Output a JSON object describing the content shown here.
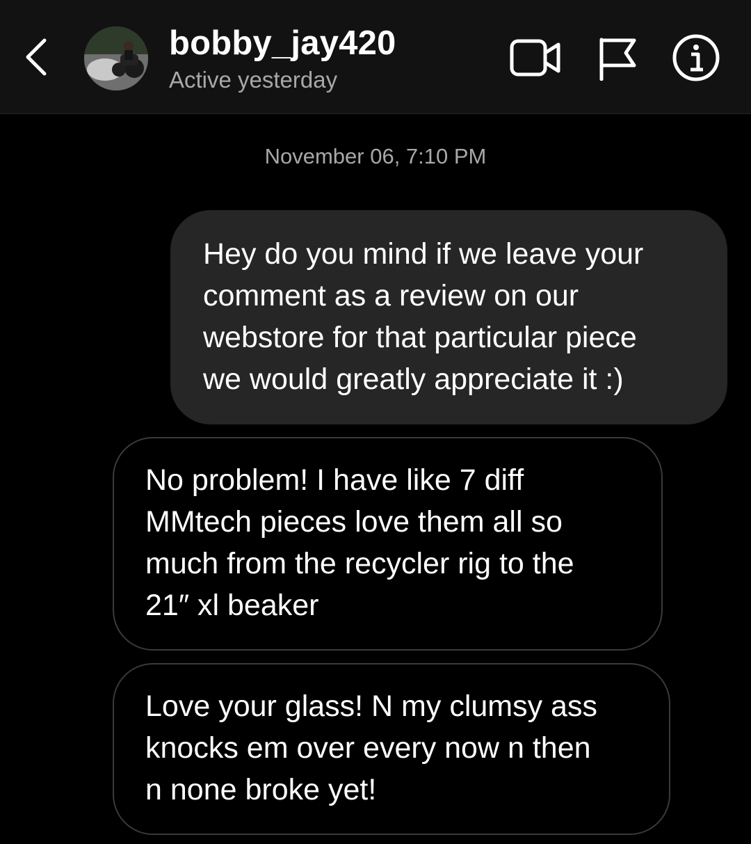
{
  "header": {
    "username": "bobby_jay420",
    "status": "Active yesterday",
    "icons": {
      "back": "chevron-left-icon",
      "video": "video-camera-icon",
      "flag": "flag-icon",
      "info": "info-icon"
    }
  },
  "conversation": {
    "timestamp": "November 06, 7:10 PM",
    "messages": [
      {
        "direction": "sent",
        "text": "Hey do you mind if we leave your\ncomment as a review on our\nwebstore for that particular piece\nwe would greatly appreciate it :)"
      },
      {
        "direction": "received",
        "text": "No problem! I have like 7 diff\nMMtech pieces love them all so\nmuch from the recycler rig to the\n21″ xl beaker"
      },
      {
        "direction": "received",
        "text": "Love your glass! N my clumsy ass\nknocks em over every now n then\nn none broke yet!"
      }
    ]
  },
  "colors": {
    "background": "#000000",
    "header_background": "#121212",
    "sent_bubble": "#262626",
    "received_bubble_border": "#3a3a3a",
    "secondary_text": "#a8a8a8"
  }
}
